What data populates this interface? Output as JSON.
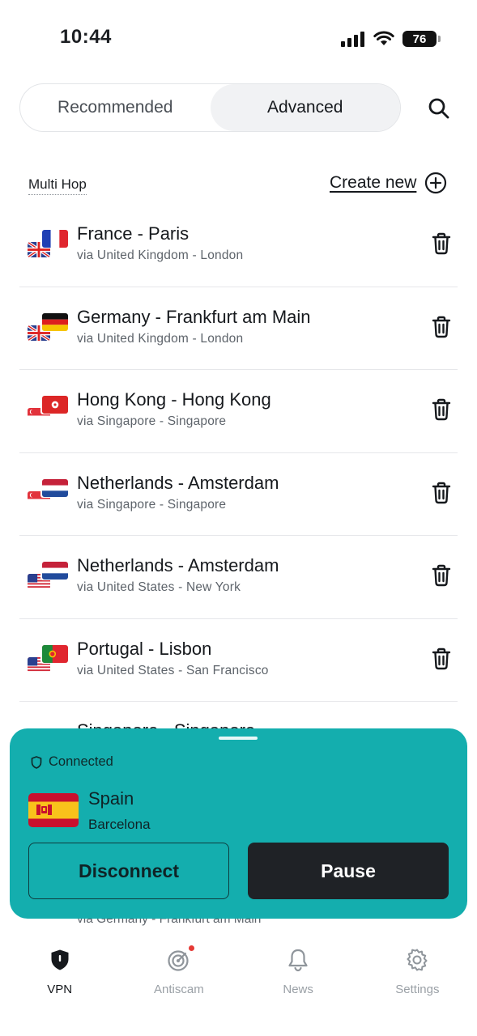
{
  "status_bar": {
    "time": "10:44",
    "battery": "76"
  },
  "tabs": [
    {
      "label": "Recommended",
      "active": false
    },
    {
      "label": "Advanced",
      "active": true
    }
  ],
  "section": {
    "title": "Multi Hop",
    "create_new": "Create new"
  },
  "hops": [
    {
      "title": "France - Paris",
      "via": "via United Kingdom - London",
      "exit_flag": "fr",
      "entry_flag": "gb"
    },
    {
      "title": "Germany - Frankfurt am Main",
      "via": "via United Kingdom - London",
      "exit_flag": "de",
      "entry_flag": "gb"
    },
    {
      "title": "Hong Kong - Hong Kong",
      "via": "via Singapore - Singapore",
      "exit_flag": "hk",
      "entry_flag": "sg"
    },
    {
      "title": "Netherlands - Amsterdam",
      "via": "via Singapore - Singapore",
      "exit_flag": "nl",
      "entry_flag": "sg"
    },
    {
      "title": "Netherlands - Amsterdam",
      "via": "via United States - New York",
      "exit_flag": "nl",
      "entry_flag": "us"
    },
    {
      "title": "Portugal - Lisbon",
      "via": "via United States - San Francisco",
      "exit_flag": "pt",
      "entry_flag": "us"
    }
  ],
  "partially_hidden": {
    "row_title": "Singapore - Singapore",
    "row_via": "via Germany - Frankfurt am Main"
  },
  "connection": {
    "status": "Connected",
    "country": "Spain",
    "city": "Barcelona",
    "disconnect_label": "Disconnect",
    "pause_label": "Pause",
    "panel_color": "#14aeae"
  },
  "nav": [
    {
      "label": "VPN",
      "icon": "vpn-shield-icon",
      "active": true
    },
    {
      "label": "Antiscam",
      "icon": "radar-icon",
      "active": false,
      "badge": true
    },
    {
      "label": "News",
      "icon": "bell-icon",
      "active": false
    },
    {
      "label": "Settings",
      "icon": "gear-icon",
      "active": false
    }
  ]
}
